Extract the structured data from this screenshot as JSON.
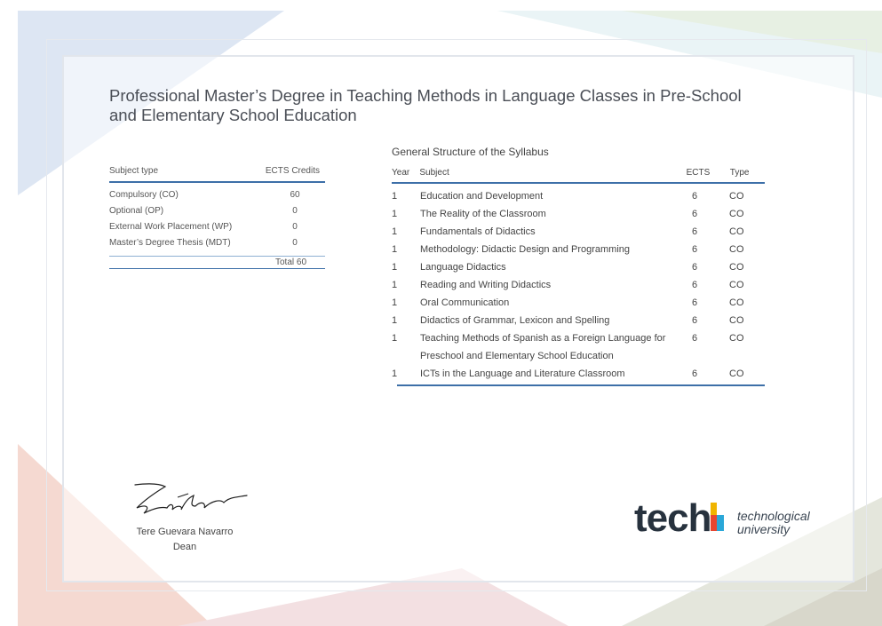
{
  "document": {
    "title": "Professional Master’s Degree in Teaching Methods in Language Classes in Pre-School and Elementary School Education"
  },
  "summary_table": {
    "headers": [
      "Subject type",
      "ECTS Credits"
    ],
    "rows": [
      {
        "type": "Compulsory (CO)",
        "credits": "60"
      },
      {
        "type": "Optional (OP)",
        "credits": "0"
      },
      {
        "type": "External Work Placement (WP)",
        "credits": "0"
      },
      {
        "type": "Master’s Degree Thesis (MDT)",
        "credits": "0"
      }
    ],
    "total": "Total 60"
  },
  "syllabus": {
    "title": "General Structure of the Syllabus",
    "headers": {
      "year": "Year",
      "subject": "Subject",
      "ects": "ECTS",
      "type": "Type"
    },
    "rows": [
      {
        "year": "1",
        "subject": "Education and Development",
        "ects": "6",
        "type": "CO"
      },
      {
        "year": "1",
        "subject": "The Reality of the Classroom",
        "ects": "6",
        "type": "CO"
      },
      {
        "year": "1",
        "subject": "Fundamentals of Didactics",
        "ects": "6",
        "type": "CO"
      },
      {
        "year": "1",
        "subject": "Methodology: Didactic Design and Programming",
        "ects": "6",
        "type": "CO"
      },
      {
        "year": "1",
        "subject": "Language Didactics",
        "ects": "6",
        "type": "CO"
      },
      {
        "year": "1",
        "subject": "Reading and Writing Didactics",
        "ects": "6",
        "type": "CO"
      },
      {
        "year": "1",
        "subject": "Oral Communication",
        "ects": "6",
        "type": "CO"
      },
      {
        "year": "1",
        "subject": "Didactics of Grammar, Lexicon and Spelling",
        "ects": "6",
        "type": "CO"
      },
      {
        "year": "1",
        "subject": "Teaching Methods of Spanish as a Foreign Language for Preschool and Elementary School Education",
        "ects": "6",
        "type": "CO"
      },
      {
        "year": "1",
        "subject": "ICTs in the Language and Literature Classroom",
        "ects": "6",
        "type": "CO"
      }
    ]
  },
  "signature": {
    "name": "Tere Guevara Navarro",
    "role": "Dean"
  },
  "logo": {
    "word": "tech",
    "line1": "technological",
    "line2": "university"
  },
  "colors": {
    "accent": "#3d6fa8",
    "logo_dark": "#27323e"
  }
}
